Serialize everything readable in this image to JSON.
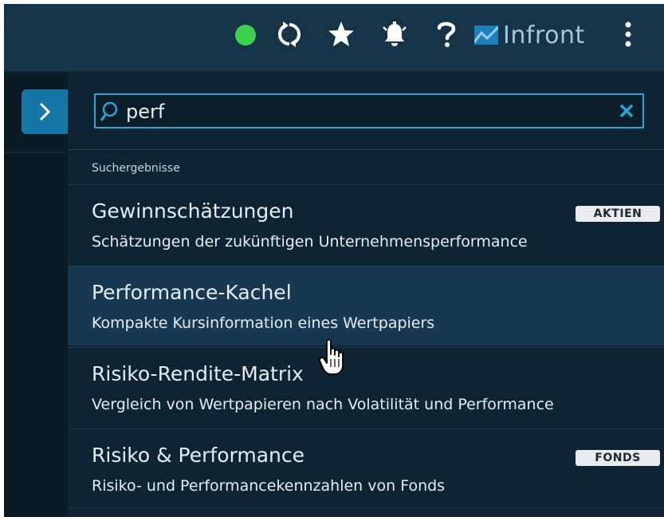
{
  "header": {
    "brand_name": "Infront",
    "icons": [
      "status-online-icon",
      "refresh-icon",
      "star-icon",
      "alarm-bell-icon",
      "help-icon",
      "kebab-menu-icon"
    ],
    "status_color": "#3cd04d"
  },
  "sidebar": {
    "expand_icon": "chevron-right-icon",
    "accent_color": "#1677a6"
  },
  "search": {
    "value": "perf",
    "placeholder": "",
    "accent_color": "#2fa3d6"
  },
  "results": {
    "section_label": "Suchergebnisse",
    "items": [
      {
        "title": "Gewinnschätzungen",
        "description": "Schätzungen der zukünftigen Unternehmensperformance",
        "badge": "AKTIEN"
      },
      {
        "title": "Performance-Kachel",
        "description": "Kompakte Kursinformation eines Wertpapiers",
        "badge": ""
      },
      {
        "title": "Risiko-Rendite-Matrix",
        "description": "Vergleich von Wertpapieren nach Volatilität und Performance",
        "badge": ""
      },
      {
        "title": "Risiko & Performance",
        "description": "Risiko- und Performancekennzahlen von Fonds",
        "badge": "FONDS"
      }
    ]
  }
}
